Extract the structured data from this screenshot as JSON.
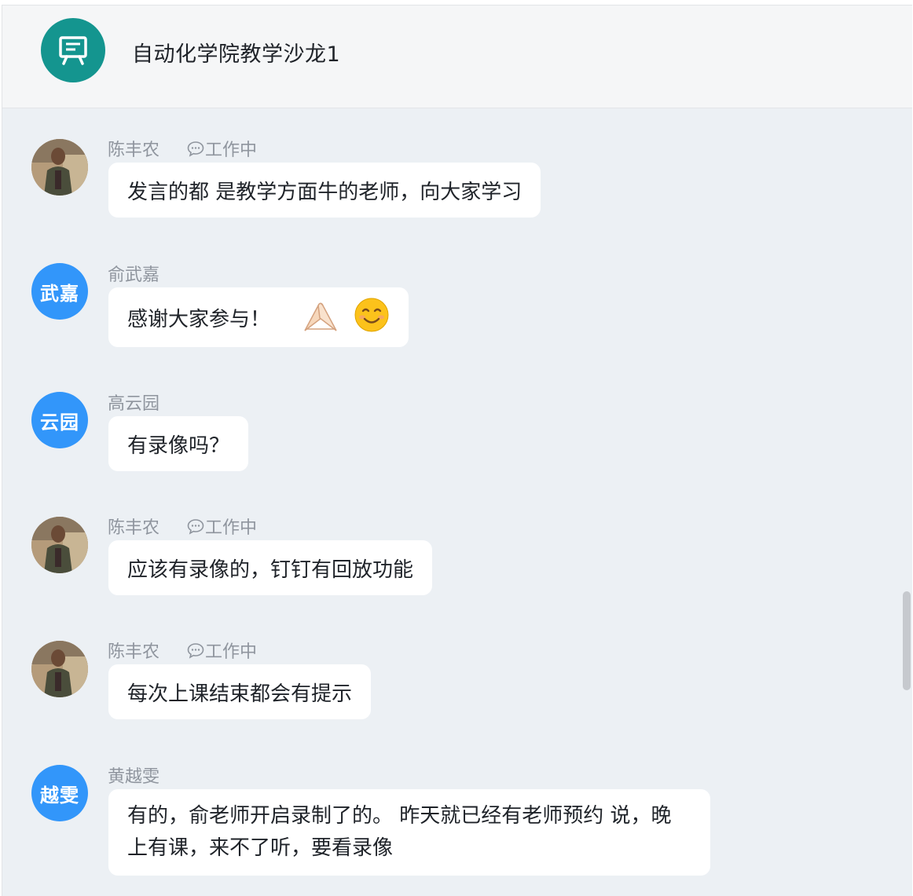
{
  "group": {
    "title": "自动化学院教学沙龙1",
    "icon": "group-chalkboard-icon",
    "accent": "#14958f"
  },
  "status_icon": "chat-bubble-icon",
  "messages": [
    {
      "sender": "陈丰农",
      "avatar_type": "photo",
      "status": "工作中",
      "text": "发言的都 是教学方面牛的老师，向大家学习"
    },
    {
      "sender": "俞武嘉",
      "avatar_type": "text",
      "avatar_text": "武嘉",
      "text": "感谢大家参与！",
      "emojis": [
        "folded-hands-emoji",
        "smiling-face-emoji"
      ]
    },
    {
      "sender": "高云园",
      "avatar_type": "text",
      "avatar_text": "云园",
      "text": "有录像吗？"
    },
    {
      "sender": "陈丰农",
      "avatar_type": "photo",
      "status": "工作中",
      "text": "应该有录像的，钉钉有回放功能"
    },
    {
      "sender": "陈丰农",
      "avatar_type": "photo",
      "status": "工作中",
      "text": "每次上课结束都会有提示"
    },
    {
      "sender": "黄越雯",
      "avatar_type": "text",
      "avatar_text": "越雯",
      "text": "有的，俞老师开启录制了的。 昨天就已经有老师预约 说，晚上有课，来不了听，要看录像"
    }
  ],
  "colors": {
    "avatar_blue": "#3296fa",
    "chat_bg": "#ecf0f4",
    "bubble_bg": "#ffffff"
  }
}
